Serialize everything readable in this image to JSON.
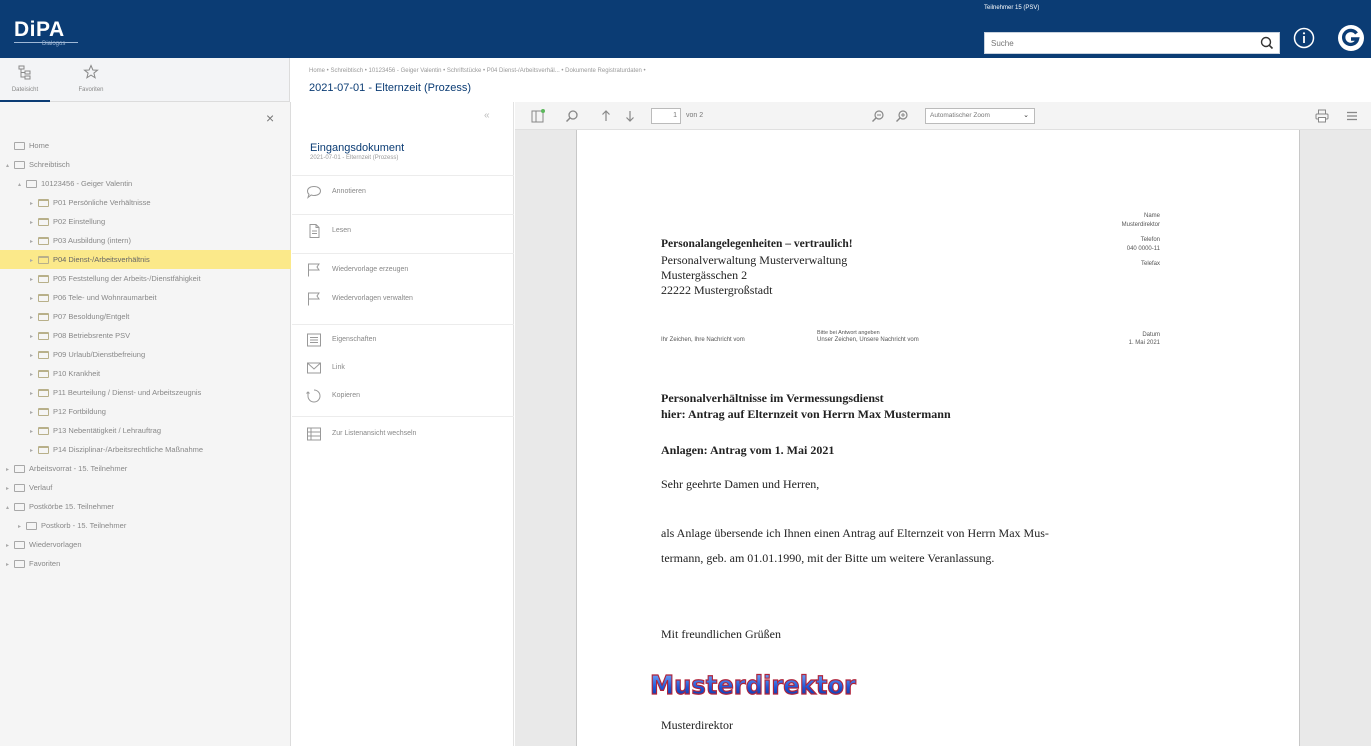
{
  "app": {
    "logo": "DiPA",
    "logo_sub": "Dialogos",
    "user_label": "Teilnehmer 15 (PSV)",
    "search_placeholder": "Suche"
  },
  "tabs": [
    {
      "label": "Dateisicht",
      "icon": "tree-icon"
    },
    {
      "label": "Favoriten",
      "icon": "star-icon"
    }
  ],
  "breadcrumb": "Home • Schreibtisch • 10123456 - Geiger Valentin • Schriftstücke • P04 Dienst-/Arbeitsverhäl... • Dokumente Registraturdaten •",
  "page_title": "2021-07-01 - Elternzeit (Prozess)",
  "sidebar": {
    "close": "×",
    "tree": [
      {
        "label": "Home",
        "indent": 0,
        "icon": "home-icon",
        "twisty": ""
      },
      {
        "label": "Schreibtisch",
        "indent": 0,
        "icon": "desk-icon",
        "twisty": "▴"
      },
      {
        "label": "10123456 - Geiger Valentin",
        "indent": 1,
        "icon": "file-icon",
        "twisty": "▴"
      },
      {
        "label": "P01 Persönliche Verhältnisse",
        "indent": 2,
        "icon": "folder-icon",
        "twisty": "▸"
      },
      {
        "label": "P02 Einstellung",
        "indent": 2,
        "icon": "folder-icon",
        "twisty": "▸"
      },
      {
        "label": "P03 Ausbildung (intern)",
        "indent": 2,
        "icon": "folder-icon",
        "twisty": "▸"
      },
      {
        "label": "P04 Dienst-/Arbeitsverhältnis",
        "indent": 2,
        "icon": "folder-icon",
        "twisty": "▸",
        "selected": true
      },
      {
        "label": "P05 Feststellung der Arbeits-/Dienstfähigkeit",
        "indent": 2,
        "icon": "folder-icon",
        "twisty": "▸"
      },
      {
        "label": "P06 Tele- und Wohnraumarbeit",
        "indent": 2,
        "icon": "folder-icon",
        "twisty": "▸"
      },
      {
        "label": "P07 Besoldung/Entgelt",
        "indent": 2,
        "icon": "folder-icon",
        "twisty": "▸"
      },
      {
        "label": "P08 Betriebsrente PSV",
        "indent": 2,
        "icon": "folder-icon",
        "twisty": "▸"
      },
      {
        "label": "P09 Urlaub/Dienstbefreiung",
        "indent": 2,
        "icon": "folder-icon",
        "twisty": "▸"
      },
      {
        "label": "P10 Krankheit",
        "indent": 2,
        "icon": "folder-icon",
        "twisty": "▸"
      },
      {
        "label": "P11 Beurteilung / Dienst- und Arbeitszeugnis",
        "indent": 2,
        "icon": "folder-icon",
        "twisty": "▸"
      },
      {
        "label": "P12 Fortbildung",
        "indent": 2,
        "icon": "folder-icon",
        "twisty": "▸"
      },
      {
        "label": "P13 Nebentätigkeit / Lehrauftrag",
        "indent": 2,
        "icon": "folder-icon",
        "twisty": "▸"
      },
      {
        "label": "P14 Disziplinar-/Arbeitsrechtliche Maßnahme",
        "indent": 2,
        "icon": "folder-icon",
        "twisty": "▸"
      },
      {
        "label": "Arbeitsvorrat - 15. Teilnehmer",
        "indent": 0,
        "icon": "list-icon",
        "twisty": "▸"
      },
      {
        "label": "Verlauf",
        "indent": 0,
        "icon": "clock-icon",
        "twisty": "▸"
      },
      {
        "label": "Postkörbe 15. Teilnehmer",
        "indent": 0,
        "icon": "inbox-icon",
        "twisty": "▴"
      },
      {
        "label": "Postkorb - 15. Teilnehmer",
        "indent": 1,
        "icon": "inbox-icon",
        "twisty": "▸"
      },
      {
        "label": "Wiedervorlagen",
        "indent": 0,
        "icon": "flag-icon",
        "twisty": "▸"
      },
      {
        "label": "Favoriten",
        "indent": 0,
        "icon": "star-icon",
        "twisty": "▸"
      }
    ]
  },
  "actions": {
    "doc_title": "Eingangsdokument",
    "doc_sub": "2021-07-01 - Elternzeit (Prozess)",
    "items": [
      {
        "label": "Annotieren",
        "icon": "comment-icon"
      },
      {
        "label": "Lesen",
        "icon": "document-icon"
      },
      {
        "label": "Wiedervorlage erzeugen",
        "icon": "flag-icon"
      },
      {
        "label": "Wiedervorlagen verwalten",
        "icon": "flag-icon"
      },
      {
        "label": "Eigenschaften",
        "icon": "properties-icon"
      },
      {
        "label": "Link",
        "icon": "mail-icon"
      },
      {
        "label": "Kopieren",
        "icon": "copy-icon"
      },
      {
        "label": "Zur Listenansicht wechseln",
        "icon": "list-icon"
      }
    ]
  },
  "viewer": {
    "page": "1",
    "page_of": "von 2",
    "zoom": "Automatischer Zoom"
  },
  "letter": {
    "header_right": [
      "Name",
      "Musterdirektor",
      "Telefon",
      "040 0000-11",
      "Telefax"
    ],
    "confidential": "Personalangelegenheiten – vertraulich!",
    "address": [
      "Personalverwaltung Musterverwaltung",
      "Mustergässchen 2",
      "22222 Mustergroßstadt"
    ],
    "ref_left": "Ihr Zeichen, Ihre Nachricht vom",
    "ref_middle_top": "Bitte bei Antwort angeben",
    "ref_middle": "Unser Zeichen, Unsere Nachricht vom",
    "date_label": "Datum",
    "date_value": "1. Mai 2021",
    "subject1": "Personalverhältnisse im Vermessungsdienst",
    "subject2": "hier: Antrag auf Elternzeit von Herrn Max Mustermann",
    "attachments": "Anlagen: Antrag vom 1. Mai 2021",
    "salutation": "Sehr geehrte Damen und Herren,",
    "body1": "als Anlage übersende ich Ihnen einen Antrag auf Elternzeit von Herrn Max Mus-",
    "body2": "termann, geb. am 01.01.1990, mit der Bitte um weitere Veranlassung.",
    "closing": "Mit freundlichen Grüßen",
    "signature_logo": "Musterdirektor",
    "signer": "Musterdirektor"
  },
  "colors": {
    "topbar": "#0b3c74",
    "selected": "#fbe98a",
    "title": "#0b3c74"
  }
}
